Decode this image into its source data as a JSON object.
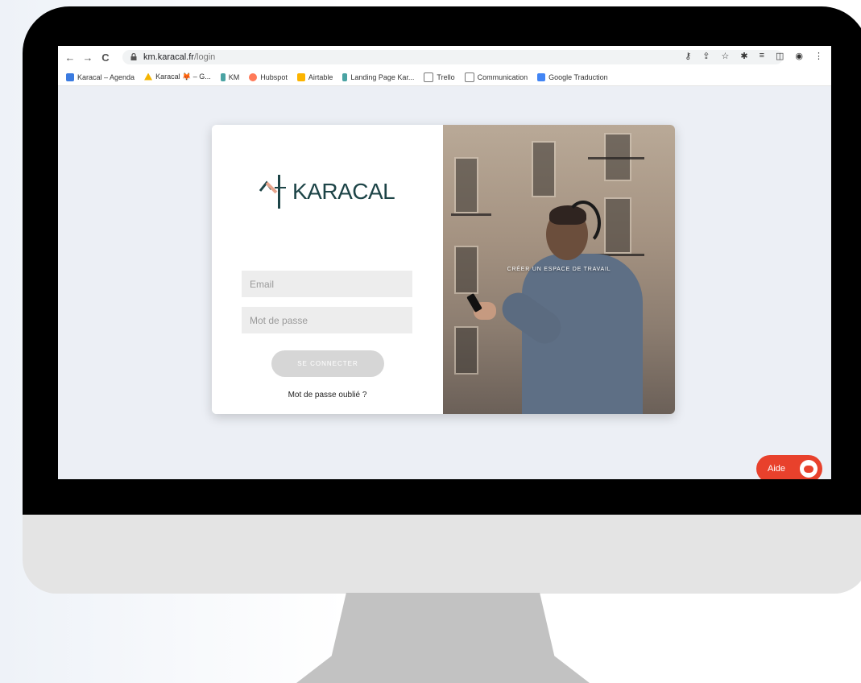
{
  "browser": {
    "back_icon": "←",
    "forward_icon": "→",
    "reload_icon": "C",
    "url_host": "km.karacal.fr",
    "url_path": "/login",
    "toolbar_icons": [
      "key-icon",
      "share-icon",
      "star-icon",
      "puzzle-icon",
      "playlist-icon",
      "sidepanel-icon",
      "profile-icon",
      "menu-icon"
    ]
  },
  "bookmarks": [
    {
      "label": "Karacal – Agenda",
      "icon": "calendar-icon",
      "color": "#3b7be0"
    },
    {
      "label": "Karacal 🦊 – G...",
      "icon": "drive-icon",
      "color": "#f4b400"
    },
    {
      "label": "KM",
      "icon": "karacal-icon",
      "color": "#4aa3a3"
    },
    {
      "label": "Hubspot",
      "icon": "hubspot-icon",
      "color": "#ff7a59"
    },
    {
      "label": "Airtable",
      "icon": "airtable-icon",
      "color": "#fcb400"
    },
    {
      "label": "Landing Page Kar...",
      "icon": "karacal-icon",
      "color": "#4aa3a3"
    },
    {
      "label": "Trello",
      "icon": "folder-icon",
      "color": "#777777"
    },
    {
      "label": "Communication",
      "icon": "folder-icon",
      "color": "#777777"
    },
    {
      "label": "Google Traduction",
      "icon": "translate-icon",
      "color": "#4285f4"
    }
  ],
  "login": {
    "brand": "KARACAL",
    "email_placeholder": "Email",
    "password_placeholder": "Mot de passe",
    "submit_label": "SE CONNECTER",
    "forgot_label": "Mot de passe oublié ?",
    "workspace_label": "CRÉER UN ESPACE DE TRAVAIL"
  },
  "help": {
    "label": "Aide",
    "icon": "chat-bubble-icon",
    "color": "#e8412c"
  }
}
